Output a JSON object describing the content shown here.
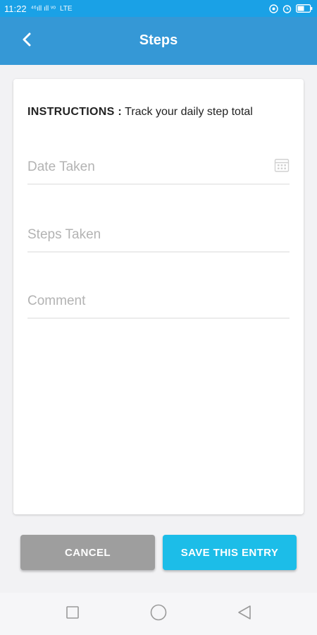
{
  "status_bar": {
    "time": "11:22",
    "signal_text": "⁴⁶ıll ıll ᵛᵒ",
    "network_badge": "LTE"
  },
  "app_bar": {
    "title": "Steps",
    "back_icon": "chevron-left-icon",
    "color": "#3598d6"
  },
  "form": {
    "instructions_label": "INSTRUCTIONS :",
    "instructions_text": " Track your daily step total",
    "date_placeholder": "Date Taken",
    "steps_placeholder": "Steps Taken",
    "comment_placeholder": "Comment",
    "calendar_icon": "calendar-icon"
  },
  "buttons": {
    "cancel_label": "CANCEL",
    "save_label": "SAVE THIS ENTRY",
    "cancel_color": "#9e9e9e",
    "save_color": "#1cbde8"
  },
  "nav": {
    "recent_icon": "square-icon",
    "home_icon": "circle-icon",
    "back_icon": "triangle-back-icon"
  }
}
